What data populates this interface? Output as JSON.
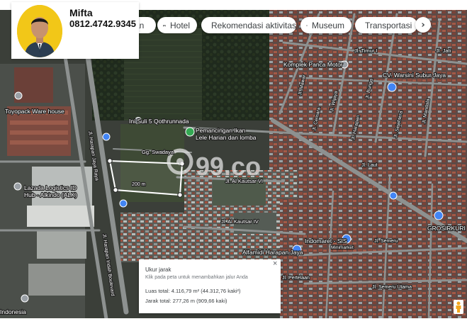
{
  "contact": {
    "name": "Mifta",
    "phone": "0812.4742.9345"
  },
  "chips": [
    {
      "label": "an",
      "icon": "restaurant-icon"
    },
    {
      "label": "Hotel",
      "icon": "bed-icon"
    },
    {
      "label": "Rekomendasi aktivitas",
      "icon": "camera-icon"
    },
    {
      "label": "Museum",
      "icon": "museum-icon"
    },
    {
      "label": "Transportasi",
      "icon": "train-icon"
    }
  ],
  "chips_next": "›",
  "watermark": "99.co",
  "map_labels": {
    "toyopack": "Toyopack Ware house",
    "lazada_1": "Lazada Logistics ID",
    "lazada_2": "Hub - Alkindo (ALK)",
    "ini_sulis": "Ini Suli 5 Qothrunnada",
    "pemancingan_1": "Pemancingan Ikan",
    "pemancingan_2": "Lele Harian dan lomba",
    "gg_swadaya": "Gg. Swadaya",
    "jl_al_kautsar_vi": "Jl. Al Kautsar VI",
    "jl_al_kautsar_iv": "Jl. Al Kautsar IV",
    "komplek": "Komplek Panca Motor",
    "cv_warsini": "CV. Warsini Subur Jaya",
    "jl_timur": "Jl. Timur I",
    "jl_jati": "Jl. Jati",
    "jl_mawar": "Jl. Mawar",
    "jl_wijaya": "Jl. Wijaya",
    "jl_bunga": "Jl. Bunga",
    "jl_mandala": "Jl. Mandala",
    "jl_cemara": "Jl. Cemara",
    "jl_harapan": "Jl. Harapan",
    "jl_sejahtera": "Jl. Sejahtera",
    "jl_lautan": "Jl. Laut",
    "indomaret": "Indomaret - SIS",
    "minimarket": "Minimarket",
    "grosir": "GROSIRKURI",
    "jl_semeru": "Jl. Semeru",
    "jl_semeru_utama": "Jl. Semeru Utama",
    "alfamidi": "Alfamidi Harapan Jaya",
    "jl_pertelaan": "Jl. Pertelaan",
    "jl_harapan_jaya_main": "Jl. Harapan Jaya Raya",
    "jl_harapan_indah": "Jl. Harapan Indah Boulevard",
    "indonesia": "Indonesia",
    "measure_label": "200 m"
  },
  "measure_panel": {
    "title": "Ukur jarak",
    "hint": "Klik pada peta untuk menambahkan jalur Anda",
    "area": "Luas total: 4.116,79 m² (44.312,76 kaki²)",
    "distance": "Jarak total: 277,26 m (909,66 kaki)",
    "close": "×"
  },
  "colors": {
    "measure_line": "#ffffff",
    "pin_blue": "#4285f4",
    "pin_green": "#34a853",
    "avatar_bg": "#f2c718"
  }
}
